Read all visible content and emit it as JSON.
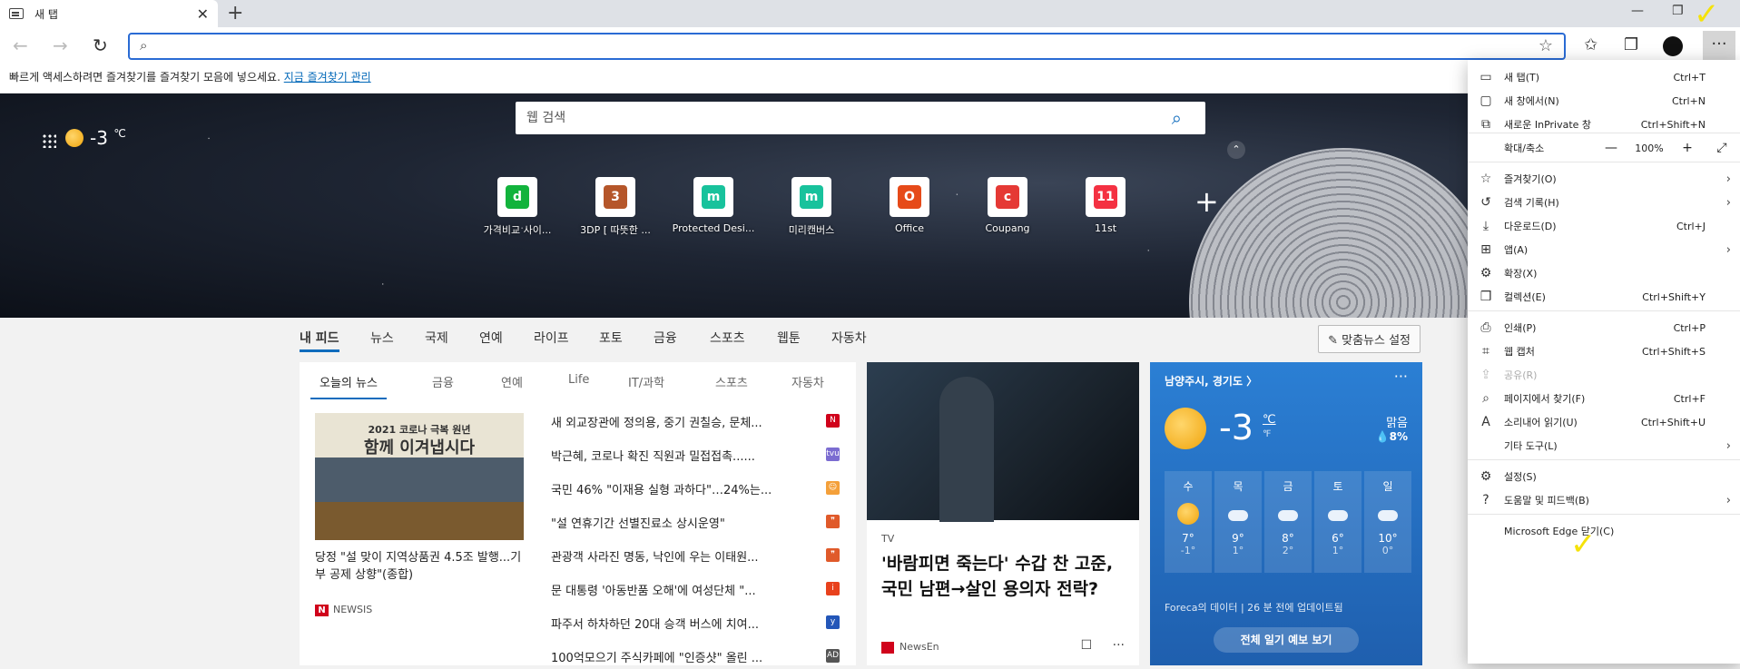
{
  "tab": {
    "title": "새 탭",
    "close": "✕",
    "new_tab": "+"
  },
  "window": {
    "minimize": "—",
    "restore": "❐"
  },
  "favbar": {
    "text": "빠르게 액세스하려면 즐겨찾기를 즐겨찾기 모음에 넣으세요.",
    "link": "지금 즐겨찾기 관리"
  },
  "hero": {
    "weather_temp": "-3",
    "weather_unit": "℃",
    "search_placeholder": "웹 검색",
    "quick_links": [
      {
        "label": "가격비교 사이...",
        "icon_text": "d",
        "color": "#12b33c"
      },
      {
        "label": "3DP [ 따뜻한 ...",
        "icon_text": "3",
        "color": "#b5562a"
      },
      {
        "label": "Protected Desi...",
        "icon_text": "m",
        "color": "#18c29c"
      },
      {
        "label": "미리캔버스",
        "icon_text": "m",
        "color": "#18c29c"
      },
      {
        "label": "Office",
        "icon_text": "O",
        "color": "#e64a19"
      },
      {
        "label": "Coupang",
        "icon_text": "c",
        "color": "#e53935"
      },
      {
        "label": "11st",
        "icon_text": "11",
        "color": "#f43142"
      }
    ]
  },
  "feednav": {
    "items": [
      "내 피드",
      "뉴스",
      "국제",
      "연예",
      "라이프",
      "포토",
      "금융",
      "스포츠",
      "웹툰",
      "자동차"
    ],
    "custom": "✎ 맞춤뉴스 설정"
  },
  "newscard": {
    "tabs": [
      "오늘의 뉴스",
      "금융",
      "연예",
      "Life",
      "IT/과학",
      "스포츠",
      "자동차"
    ],
    "image_title1": "2021 코로나 극복 원년",
    "image_title2": "함께 이겨냅시다",
    "headline": "당정 \"설 맞이 지역상품권 4.5조 발행...기부 공제 상향\"(종합)",
    "source_badge": "N",
    "source": "NEWSIS",
    "list": [
      {
        "text": "새 외교장관에 정의용, 중기 권칠승, 문체...",
        "badge": "N",
        "color": "#d0021b"
      },
      {
        "text": "박근혜, 코로나 확진 직원과 밀접접촉......",
        "badge": "tvu",
        "color": "#7b6cd1"
      },
      {
        "text": "국민 46% \"이재용 실형 과하다\"…24%는...",
        "badge": "☺",
        "color": "#f4a03a"
      },
      {
        "text": "\"설 연휴기간 선별진료소 상시운영\"",
        "badge": "❞",
        "color": "#e05a2a"
      },
      {
        "text": "관광객 사라진 명동, 낙인에 우는 이태원...",
        "badge": "❞",
        "color": "#e05a2a"
      },
      {
        "text": "문 대통령 '아동반품 오해'에 여성단체 \"...",
        "badge": "i",
        "color": "#e8411c"
      },
      {
        "text": "파주서 하차하던 20대 승객 버스에 치여...",
        "badge": "y",
        "color": "#2356b8"
      },
      {
        "text": "100억모으기 주식카페에 \"인증샷\" 올린 ...",
        "badge": "AD",
        "color": "#555555"
      }
    ]
  },
  "movie": {
    "category": "TV",
    "title": "'바람피면 죽는다' 수갑 찬 고준, 국민 남편→살인 용의자 전락?",
    "source": "NewsEn",
    "bookmark": "🔖",
    "more": "···"
  },
  "weather": {
    "location": "남양주시, 경기도 〉",
    "more": "···",
    "temp": "-3",
    "unit_c": "℃",
    "unit_f": "℉",
    "condition": "맑음",
    "rain": "💧8%",
    "days": [
      {
        "day": "수",
        "hi": "7°",
        "lo": "-1°",
        "icon": "sun"
      },
      {
        "day": "목",
        "hi": "9°",
        "lo": "1°",
        "icon": "cloud"
      },
      {
        "day": "금",
        "hi": "8°",
        "lo": "2°",
        "icon": "partly"
      },
      {
        "day": "토",
        "hi": "6°",
        "lo": "1°",
        "icon": "rain"
      },
      {
        "day": "일",
        "hi": "10°",
        "lo": "0°",
        "icon": "partly"
      }
    ],
    "footer": "Foreca의 데이터 | 26 분 전에 업데이트됨",
    "button": "전체 일기 예보 보기"
  },
  "menu": {
    "items": [
      {
        "label": "새 탭(T)",
        "shortcut": "Ctrl+T",
        "icon": "▭"
      },
      {
        "label": "새 창에서(N)",
        "shortcut": "Ctrl+N",
        "icon": "▢"
      },
      {
        "label": "새로운 InPrivate 창",
        "shortcut": "Ctrl+Shift+N",
        "icon": "⧉"
      },
      {
        "label": "즐겨찾기(O)",
        "shortcut": "",
        "icon": "☆"
      },
      {
        "label": "검색 기록(H)",
        "shortcut": "",
        "icon": "↺"
      },
      {
        "label": "다운로드(D)",
        "shortcut": "Ctrl+J",
        "icon": "⤓"
      },
      {
        "label": "앱(A)",
        "shortcut": "",
        "icon": "⊞"
      },
      {
        "label": "확장(X)",
        "shortcut": "",
        "icon": "⚙"
      },
      {
        "label": "컬렉션(E)",
        "shortcut": "Ctrl+Shift+Y",
        "icon": "❒"
      },
      {
        "label": "인쇄(P)",
        "shortcut": "Ctrl+P",
        "icon": "⎙"
      },
      {
        "label": "웹 캡처",
        "shortcut": "Ctrl+Shift+S",
        "icon": "⌗"
      },
      {
        "label": "공유(R)",
        "shortcut": "",
        "icon": "⇪"
      },
      {
        "label": "페이지에서 찾기(F)",
        "shortcut": "Ctrl+F",
        "icon": "⌕"
      },
      {
        "label": "소리내어 읽기(U)",
        "shortcut": "Ctrl+Shift+U",
        "icon": "A"
      },
      {
        "label": "기타 도구(L)",
        "shortcut": "",
        "icon": ""
      },
      {
        "label": "설정(S)",
        "shortcut": "",
        "icon": "⚙"
      },
      {
        "label": "도움말 및 피드백(B)",
        "shortcut": "",
        "icon": "?"
      },
      {
        "label": "Microsoft Edge 닫기(C)",
        "shortcut": "",
        "icon": ""
      }
    ],
    "zoom": {
      "label": "확대/축소",
      "value": "100%",
      "minus": "—",
      "plus": "+",
      "fullscreen": "⤢"
    }
  }
}
